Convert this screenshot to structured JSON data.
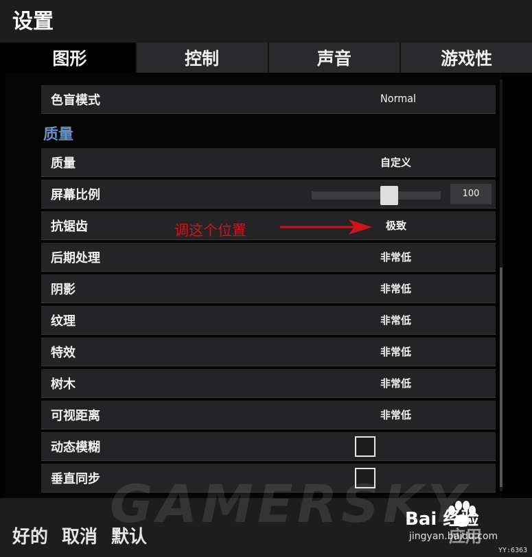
{
  "window": {
    "title": "设置"
  },
  "tabs": [
    {
      "label": "图形",
      "active": true
    },
    {
      "label": "控制",
      "active": false
    },
    {
      "label": "声音",
      "active": false
    },
    {
      "label": "游戏性",
      "active": false
    }
  ],
  "settings": {
    "colorblind": {
      "label": "色盲模式",
      "value": "Normal"
    },
    "section_title": "质量",
    "quality": {
      "label": "质量",
      "value": "自定义"
    },
    "screen_scale": {
      "label": "屏幕比例",
      "value": "100",
      "slider_fraction": 0.6
    },
    "antialiasing": {
      "label": "抗锯齿",
      "value": "极致"
    },
    "post_processing": {
      "label": "后期处理",
      "value": "非常低"
    },
    "shadows": {
      "label": "阴影",
      "value": "非常低"
    },
    "textures": {
      "label": "纹理",
      "value": "非常低"
    },
    "effects": {
      "label": "特效",
      "value": "非常低"
    },
    "foliage": {
      "label": "树木",
      "value": "非常低"
    },
    "view_distance": {
      "label": "可视距离",
      "value": "非常低"
    },
    "motion_blur": {
      "label": "动态模糊",
      "checked": false
    },
    "vsync": {
      "label": "垂直同步",
      "checked": false
    }
  },
  "annotation": {
    "text": "调这个位置",
    "color": "#d0141b"
  },
  "footer": {
    "ok": "好的",
    "cancel": "取消",
    "default": "默认"
  },
  "watermark": {
    "text": "GAMERSKY"
  },
  "brand": {
    "name": "Bai 经验",
    "url": "jingyan.baidu.com",
    "app": "应用",
    "code": "YY:6363"
  },
  "colors": {
    "accent": "#6b8fc2",
    "panel": "#242426",
    "header": "#1d1d1e"
  },
  "icons": {
    "arrow": "red-arrow-right",
    "paw": "baidu-paw-icon"
  }
}
